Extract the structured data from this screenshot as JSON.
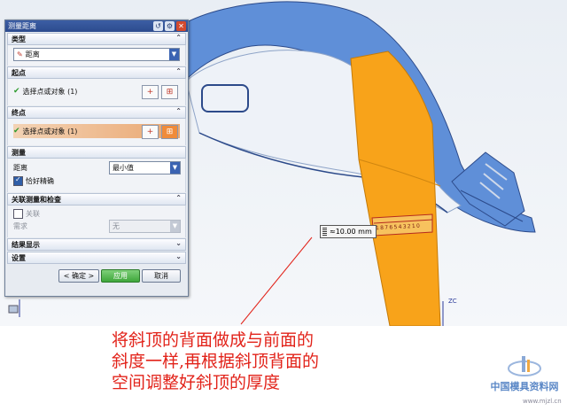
{
  "dialog": {
    "title": "测量距离",
    "sections": {
      "type": {
        "label": "类型",
        "value": "距离"
      },
      "start": {
        "label": "起点",
        "select_text": "选择点或对象 (1)"
      },
      "end": {
        "label": "终点",
        "select_text": "选择点或对象 (1)"
      },
      "measure": {
        "label": "测量",
        "distance_label": "距离",
        "distance_value": "最小值",
        "precise_label": "恰好精确"
      },
      "assoc": {
        "label": "关联测量和检查",
        "assoc_checkbox": "关联",
        "req_label": "需求",
        "req_value": "无"
      },
      "results": {
        "label": "结果显示"
      },
      "settings": {
        "label": "设置"
      }
    },
    "buttons": {
      "ok": "< 确定 >",
      "apply": "应用",
      "cancel": "取消"
    }
  },
  "viewport": {
    "measure_readout": "≈10.00 mm",
    "ruler_digits": "1 8 7 6 5 4 3 2 1 0",
    "axis_label": "ZC"
  },
  "annotation": {
    "text_line1": "将斜顶的背面做成与前面的",
    "text_line2": "斜度一样,再根据斜顶背面的",
    "text_line3": "空间调整好斜顶的厚度"
  },
  "watermark": {
    "brand": "中国模具资料网",
    "url": "www.mjzl.cn"
  },
  "colors": {
    "part_blue": "#5f8fd8",
    "slide_orange": "#f8a31a",
    "annotation_red": "#e2231a"
  }
}
